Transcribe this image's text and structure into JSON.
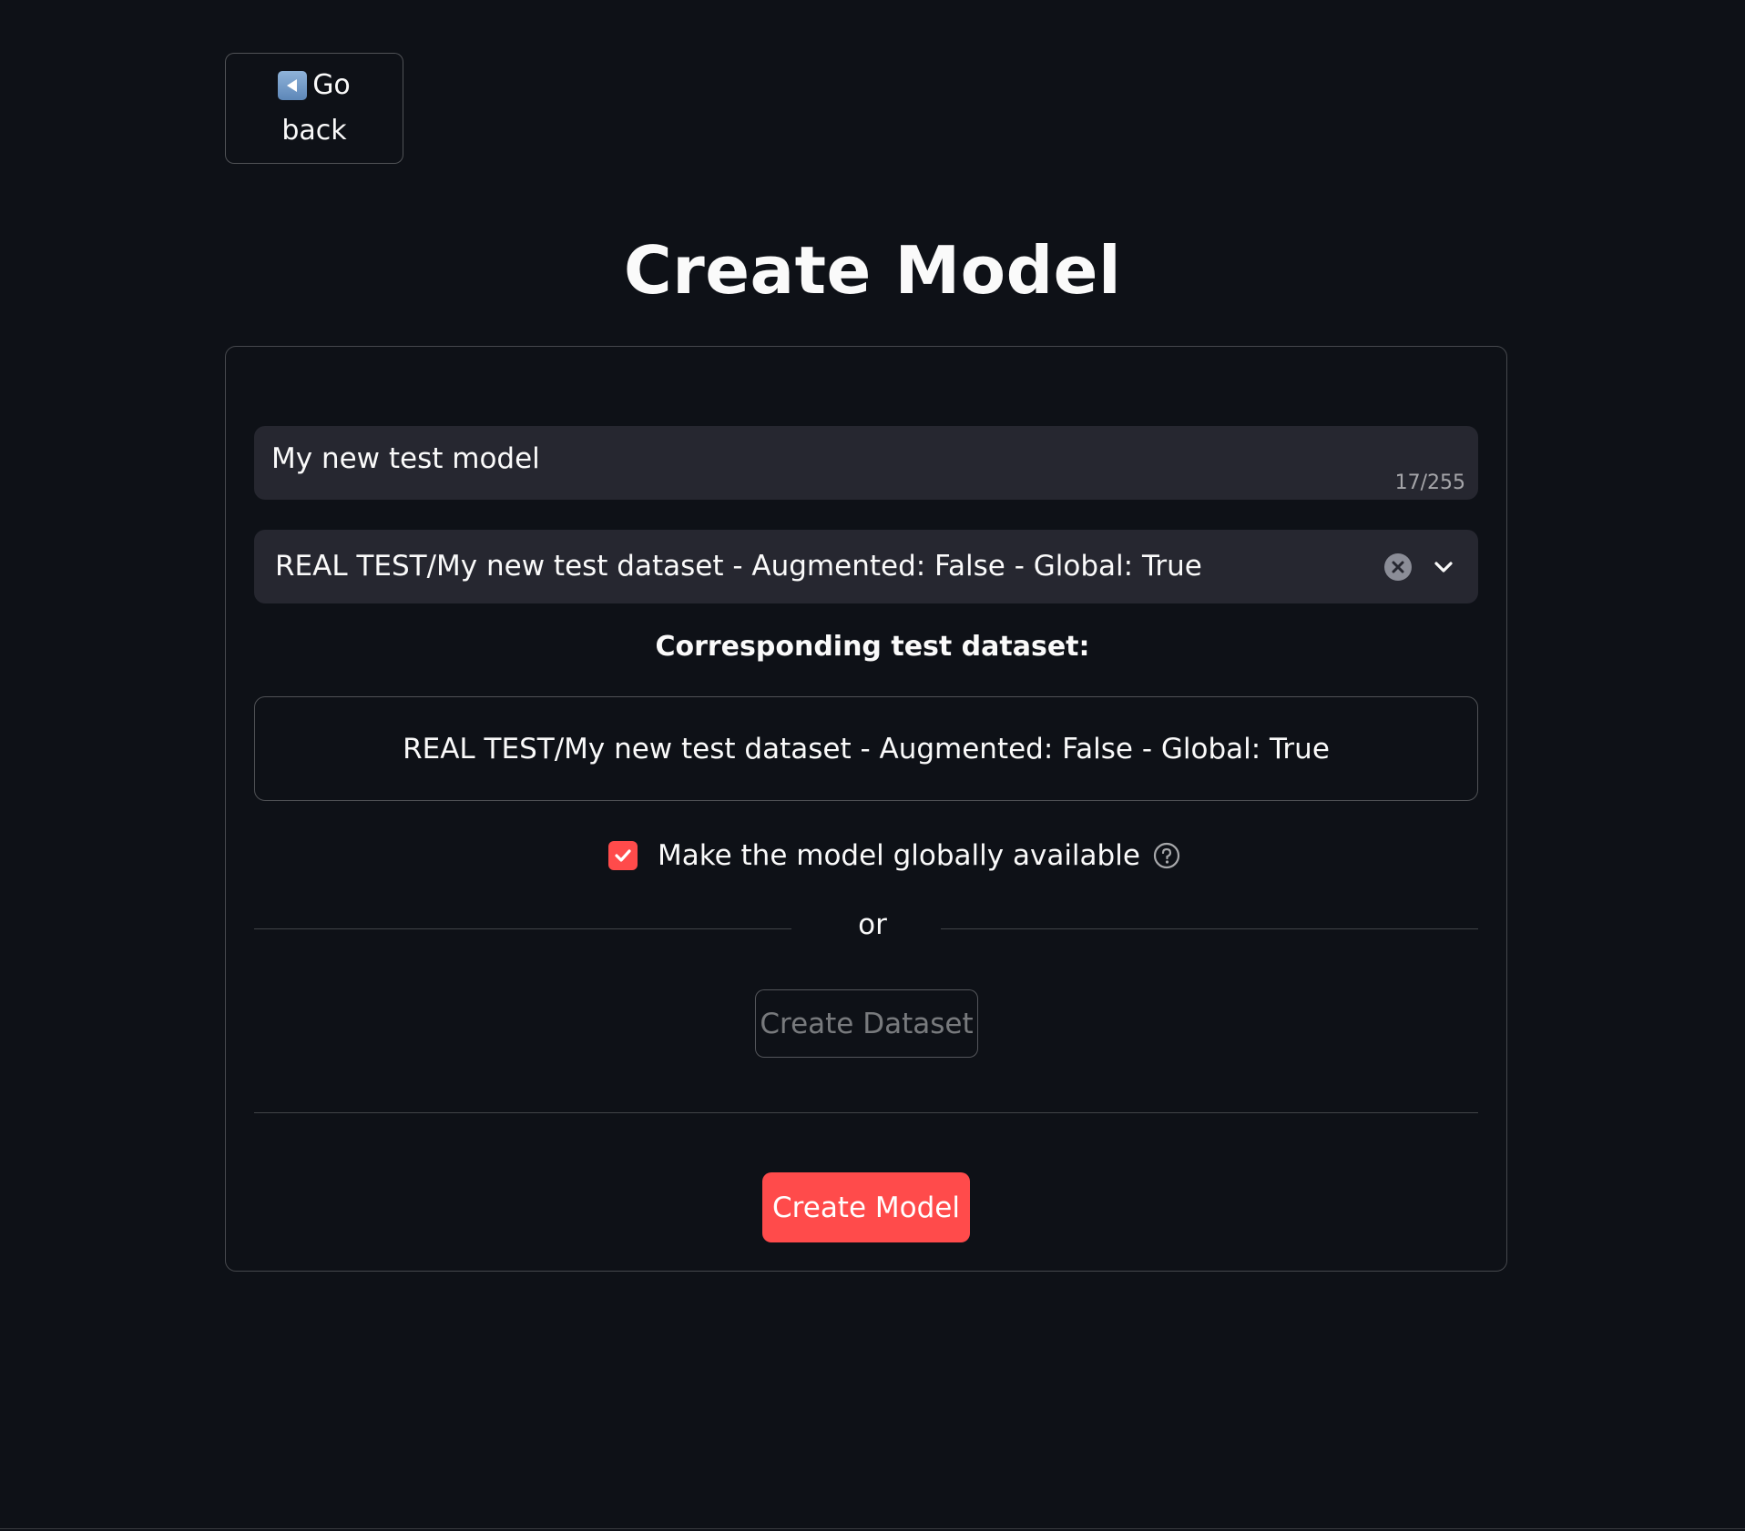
{
  "back_button": {
    "icon": "back-arrow-icon",
    "line1": "Go",
    "line2": "back"
  },
  "page": {
    "title": "Create Model"
  },
  "model_name_input": {
    "value": "My new test model",
    "counter": "17/255"
  },
  "dataset_select": {
    "selected": "REAL TEST/My new test dataset - Augmented: False - Global: True",
    "clear_icon": "clear-icon",
    "dropdown_icon": "chevron-down-icon"
  },
  "test_dataset": {
    "label": "Corresponding test dataset:",
    "value": "REAL TEST/My new test dataset - Augmented: False - Global: True"
  },
  "global_checkbox": {
    "label": "Make the model globally available",
    "checked": true,
    "help_icon": "help-icon"
  },
  "separator": {
    "text": "or"
  },
  "create_dataset_button": {
    "label": "Create Dataset"
  },
  "create_model_button": {
    "label": "Create Model"
  },
  "colors": {
    "background": "#0e1117",
    "accent": "#ff4b4b",
    "input_bg": "#262730",
    "text": "#fafafa"
  }
}
